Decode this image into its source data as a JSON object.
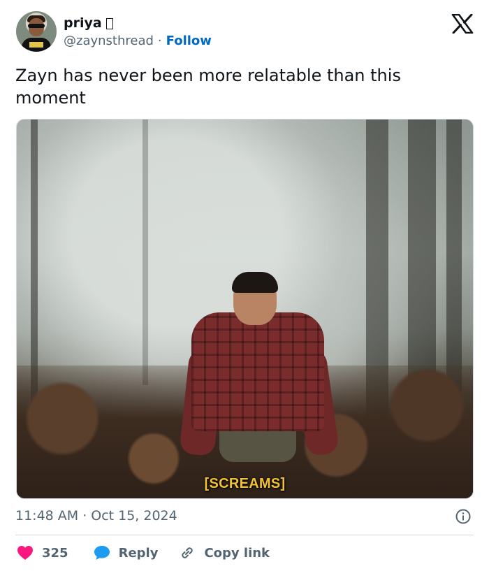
{
  "user": {
    "display_name": "priya",
    "name_emoji": "",
    "handle": "@zaynsthread",
    "separator": "·",
    "follow_label": "Follow"
  },
  "tweet": {
    "text": "Zayn has never been more relatable than this moment",
    "media_caption": "[SCREAMS]"
  },
  "meta": {
    "time": "11:48 AM",
    "separator": "·",
    "date": "Oct 15, 2024"
  },
  "actions": {
    "likes_count": "325",
    "reply_label": "Reply",
    "copy_link_label": "Copy link"
  },
  "colors": {
    "like_red": "#f91880",
    "reply_blue": "#1d9bf0",
    "follow_blue": "#0069c2",
    "caption_yellow": "#f2c230",
    "muted": "#536471"
  },
  "icons": {
    "logo": "x-logo-icon",
    "info": "info-icon",
    "like": "heart-icon",
    "reply": "speech-bubble-icon",
    "copy": "link-icon"
  }
}
